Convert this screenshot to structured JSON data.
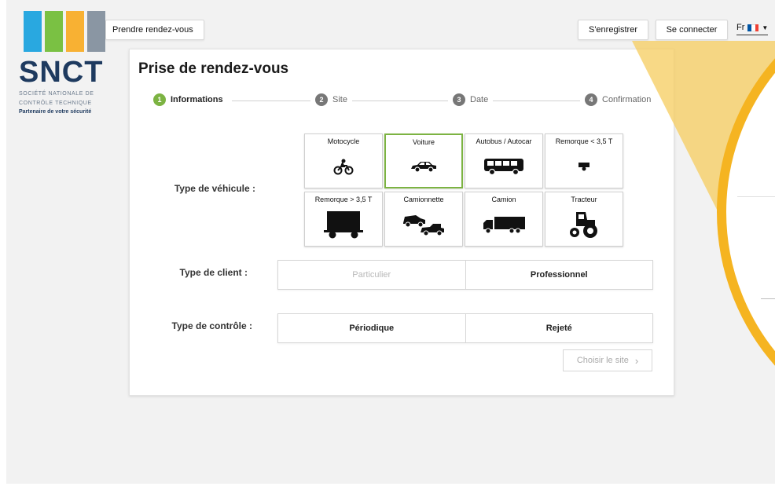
{
  "brand": {
    "name": "SNCT",
    "subtitle_line1": "SOCIÉTÉ NATIONALE DE",
    "subtitle_line2": "CONTRÔLE TECHNIQUE",
    "tagline": "Partenaire de votre sécurité",
    "colors": [
      "#29a8e0",
      "#7ac143",
      "#f8b133",
      "#8a96a3"
    ]
  },
  "topbar": {
    "appointment_button": "Prendre rendez-vous",
    "register_button": "S'enregistrer",
    "login_button": "Se connecter",
    "language": "Fr"
  },
  "card": {
    "title": "Prise de rendez-vous",
    "steps": [
      {
        "num": "1",
        "label": "Informations",
        "color": "#7cb342"
      },
      {
        "num": "2",
        "label": "Site",
        "color": "#777777"
      },
      {
        "num": "3",
        "label": "Date",
        "color": "#777777"
      },
      {
        "num": "4",
        "label": "Confirmation",
        "color": "#777777"
      }
    ],
    "vehicle_type_label": "Type de véhicule :",
    "vehicles": [
      {
        "label": "Motocycle",
        "icon": "motorcycle-icon"
      },
      {
        "label": "Voiture",
        "icon": "car-icon",
        "selected": true
      },
      {
        "label": "Autobus / Autocar",
        "icon": "bus-icon"
      },
      {
        "label": "Remorque < 3,5 T",
        "icon": "small-trailer-icon"
      },
      {
        "label": "Remorque > 3,5 T",
        "icon": "large-trailer-icon"
      },
      {
        "label": "Camionnette",
        "icon": "van-icon"
      },
      {
        "label": "Camion",
        "icon": "truck-icon"
      },
      {
        "label": "Tracteur",
        "icon": "tractor-icon"
      }
    ],
    "client_type_label": "Type de client :",
    "client_options": [
      "Particulier",
      "Professionnel"
    ],
    "control_type_label": "Type de contrôle :",
    "control_options": [
      "Périodique",
      "Rejeté"
    ],
    "next_button": "Choisir le site",
    "accent": "#7cb342"
  }
}
